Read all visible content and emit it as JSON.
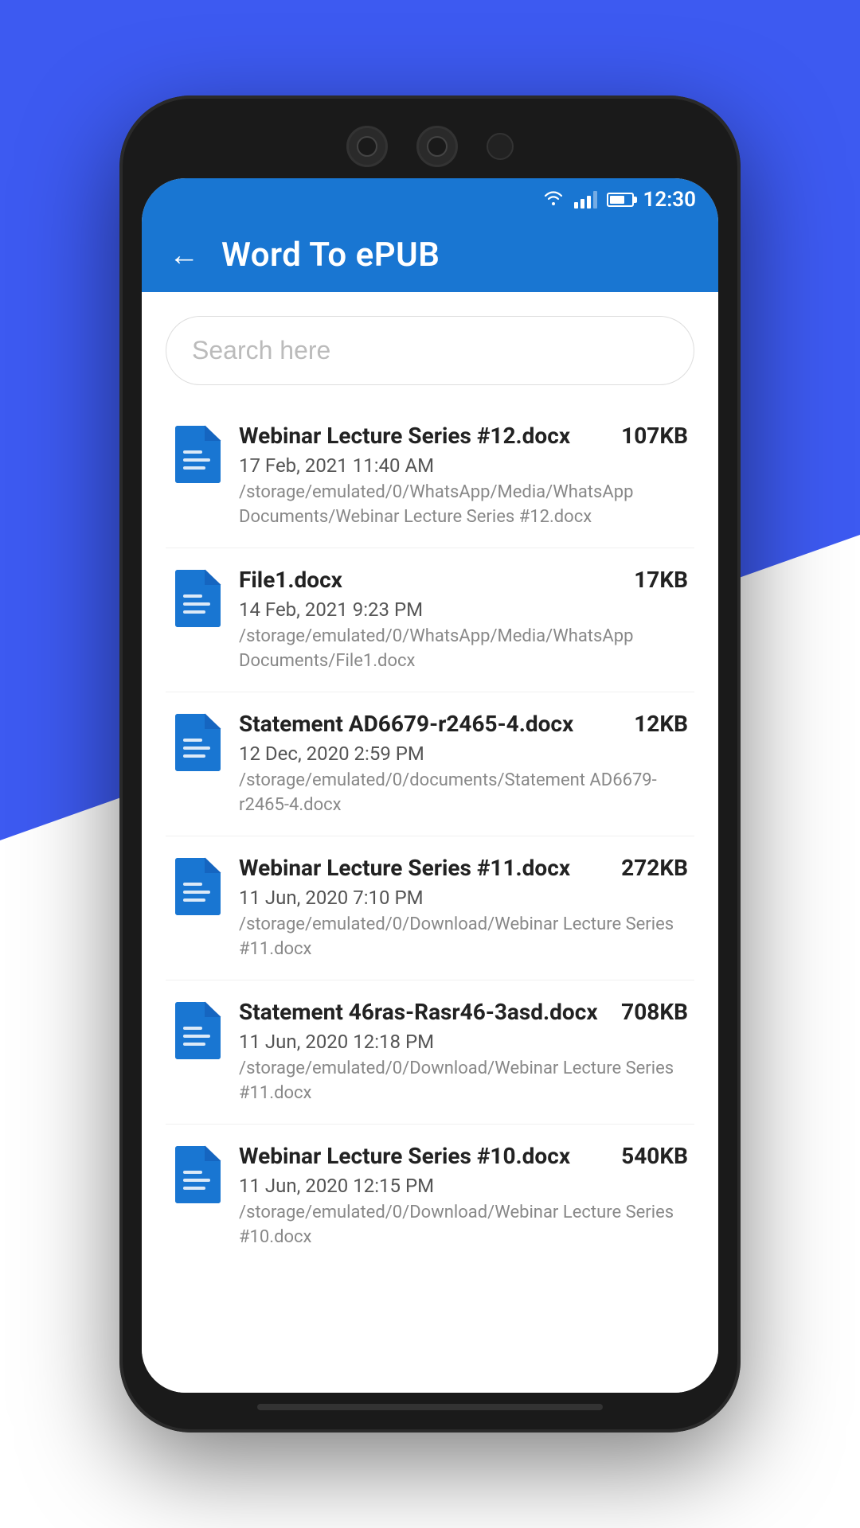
{
  "background": {
    "color_blue": "#3d5af1",
    "color_white": "#ffffff"
  },
  "status_bar": {
    "time": "12:30",
    "background": "#1976d2"
  },
  "app_bar": {
    "title": "Word To ePUB",
    "back_label": "←",
    "background": "#1976d2"
  },
  "search": {
    "placeholder": "Search here"
  },
  "files": [
    {
      "name": "Webinar Lecture Series #12.docx",
      "size": "107KB",
      "date": "17 Feb, 2021 11:40 AM",
      "path": "/storage/emulated/0/WhatsApp/Media/WhatsApp Documents/Webinar Lecture Series #12.docx"
    },
    {
      "name": "File1.docx",
      "size": "17KB",
      "date": "14 Feb, 2021 9:23 PM",
      "path": "/storage/emulated/0/WhatsApp/Media/WhatsApp Documents/File1.docx"
    },
    {
      "name": "Statement AD6679-r2465-4.docx",
      "size": "12KB",
      "date": "12 Dec, 2020 2:59 PM",
      "path": "/storage/emulated/0/documents/Statement AD6679-r2465-4.docx"
    },
    {
      "name": "Webinar Lecture Series #11.docx",
      "size": "272KB",
      "date": "11 Jun, 2020 7:10 PM",
      "path": "/storage/emulated/0/Download/Webinar Lecture Series #11.docx"
    },
    {
      "name": "Statement 46ras-Rasr46-3asd.docx",
      "size": "708KB",
      "date": "11 Jun, 2020 12:18 PM",
      "path": "/storage/emulated/0/Download/Webinar Lecture Series #11.docx"
    },
    {
      "name": "Webinar Lecture Series #10.docx",
      "size": "540KB",
      "date": "11 Jun, 2020 12:15 PM",
      "path": "/storage/emulated/0/Download/Webinar Lecture Series #10.docx"
    }
  ]
}
